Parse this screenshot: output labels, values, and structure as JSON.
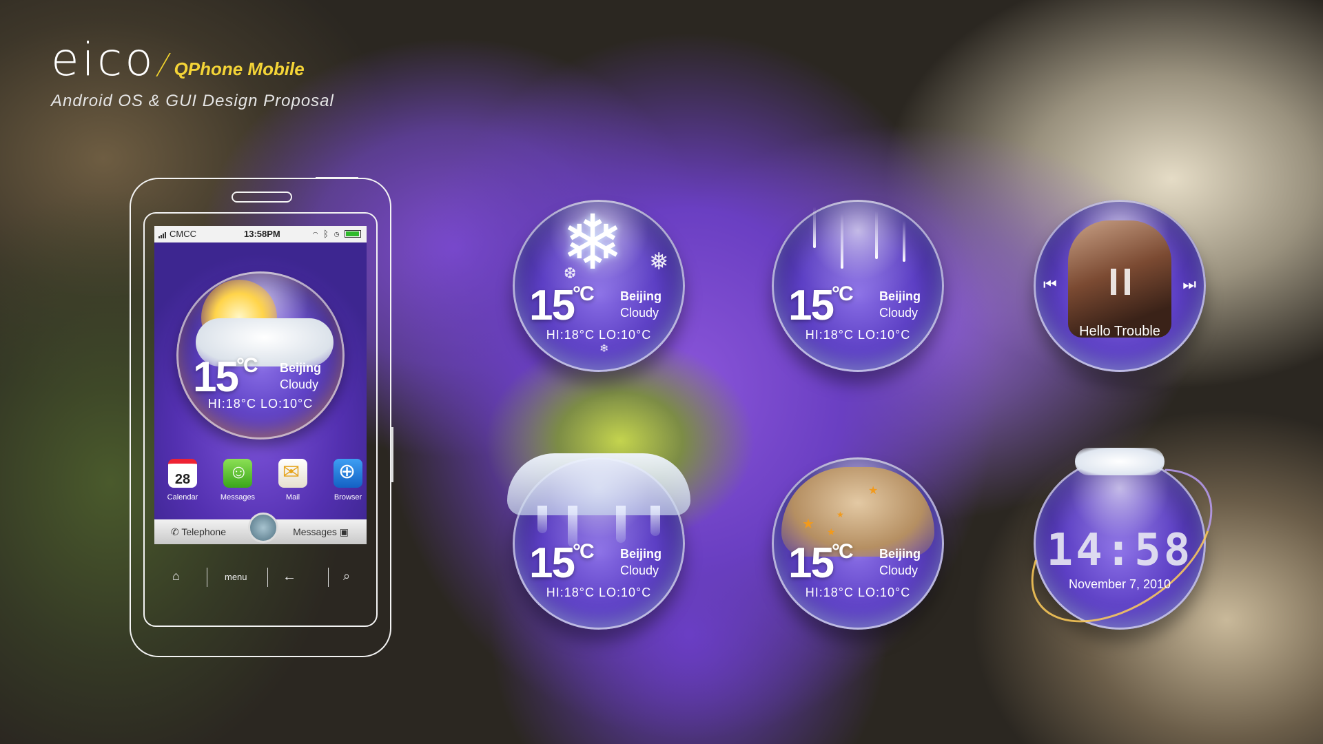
{
  "brand": {
    "logo": "eico",
    "product": "QPhone Mobile",
    "tagline": "Android OS  & GUI Design Proposal"
  },
  "phone": {
    "status": {
      "carrier": "CMCC",
      "time": "13:58PM"
    },
    "widget": {
      "temp": "15",
      "unit": "°C",
      "city": "Beijing",
      "condition": "Cloudy",
      "hilo": "HI:18°C   LO:10°C"
    },
    "apps": [
      {
        "label": "Calendar",
        "value": "28",
        "icon": "calendar-icon"
      },
      {
        "label": "Messages",
        "icon": "messages-icon"
      },
      {
        "label": "Mail",
        "icon": "mail-icon"
      },
      {
        "label": "Browser",
        "icon": "browser-icon"
      }
    ],
    "dock": {
      "left": "Telephone",
      "right": "Messages"
    },
    "nav": {
      "menu": "menu"
    }
  },
  "widgets": {
    "snow": {
      "temp": "15",
      "unit": "°C",
      "city": "Beijing",
      "condition": "Cloudy",
      "hilo": "HI:18°C   LO:10°C"
    },
    "rain": {
      "temp": "15",
      "unit": "°C",
      "city": "Beijing",
      "condition": "Cloudy",
      "hilo": "HI:18°C   LO:10°C"
    },
    "ice": {
      "temp": "15",
      "unit": "°C",
      "city": "Beijing",
      "condition": "Cloudy",
      "hilo": "HI:18°C   LO:10°C"
    },
    "sand": {
      "temp": "15",
      "unit": "°C",
      "city": "Beijing",
      "condition": "Cloudy",
      "hilo": "HI:18°C   LO:10°C"
    },
    "music": {
      "track": "Hello Trouble"
    },
    "clock": {
      "time": "14:58",
      "date": "November 7, 2010"
    }
  },
  "colors": {
    "accent": "#f4d437",
    "purple": "#5c3fc4"
  }
}
